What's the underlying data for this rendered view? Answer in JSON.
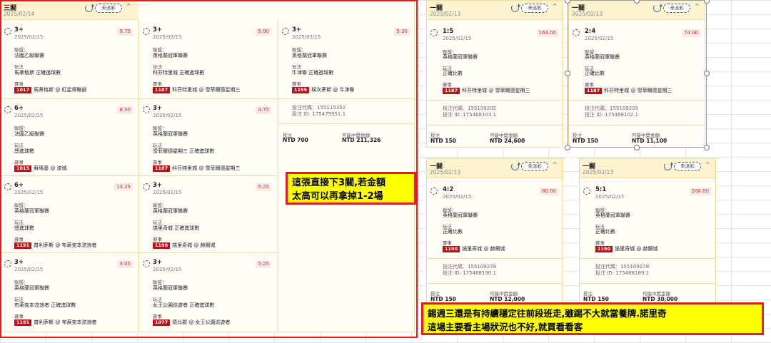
{
  "tickets": {
    "three": {
      "type": "三關",
      "date": "2025/02/14",
      "status": "未派彩",
      "collapse": "^",
      "code": "投注代碼：155115352",
      "id": "投注 ID: 175475951.1",
      "stake_label": "投注",
      "stake": "NTD 700",
      "win_label": "可能中獎金額",
      "win": "NTD 211,326"
    },
    "m1": {
      "type": "一關",
      "date": "2025/02/13",
      "status": "未派彩",
      "collapse": "^",
      "code": "投注代碼：155109205",
      "id": "投注 ID: 175468103.1",
      "stake_label": "投注",
      "stake": "NTD 150",
      "win_label": "可能中獎金額",
      "win": "NTD 24,600"
    },
    "m2": {
      "type": "一關",
      "date": "2025/02/13",
      "status": "未派彩",
      "collapse": "^",
      "code": "投注代碼：155109205",
      "id": "投注 ID: 175468102.1",
      "stake_label": "投注",
      "stake": "NTD 150",
      "win_label": "可能中獎金額",
      "win": "NTD 11,100"
    },
    "m3": {
      "type": "一關",
      "date": "2025/02/13",
      "status": "未派彩",
      "collapse": "^",
      "code": "投注代碼：155109278",
      "id": "投注 ID: 175468190.1",
      "stake_label": "投注",
      "stake": "NTD 150",
      "win_label": "可能中獎金額",
      "win": "NTD 12,000"
    },
    "m4": {
      "type": "一關",
      "date": "2025/02/13",
      "status": "未派彩",
      "collapse": "^",
      "code": "投注代碼：155109278",
      "id": "投注 ID: 175468189.1",
      "stake_label": "投注",
      "stake": "NTD 150",
      "win_label": "可能中獎金額",
      "win": "NTD 30,000"
    }
  },
  "labels": {
    "league": "聯盟：",
    "market": "玩法",
    "match": "賽事"
  },
  "legs": {
    "l1": {
      "sel": "3+",
      "date": "2025/02/15",
      "odds": "9.75",
      "league": "法國乙級聯賽",
      "market": "馬蒂格斯 正確進球數",
      "mid": "1017",
      "match": "馬蒂格斯 @ 紅星保聯部"
    },
    "l2": {
      "sel": "6+",
      "date": "2025/02/15",
      "odds": "8.50",
      "league": "法國乙級聯賽",
      "market": "總進球數",
      "mid": "1015",
      "match": "蘇瑪基 @ 波城"
    },
    "l3": {
      "sel": "6+",
      "date": "2025/02/15",
      "odds": "13.25",
      "league": "英格蘭冠軍聯賽",
      "market": "總進球數",
      "mid": "1191",
      "match": "普利茅斯 @ 布萊克本流浪者"
    },
    "l4": {
      "sel": "3+",
      "date": "2025/02/15",
      "odds": "3.05",
      "league": "英格蘭冠軍聯賽",
      "market": "布萊克本流浪者 正確進球數",
      "mid": "1191",
      "match": "普利茅斯 @ 布萊克本流浪者"
    },
    "l5": {
      "sel": "3+",
      "date": "2025/02/15",
      "odds": "5.90",
      "league": "英格蘭冠軍聯賽",
      "market": "科芬特里城 正確進球數",
      "mid": "1187",
      "match": "科芬特里城 @ 雪菲爾德星期三"
    },
    "l6": {
      "sel": "3+",
      "date": "2025/02/15",
      "odds": "4.75",
      "league": "英格蘭冠軍聯賽",
      "market": "雪菲爾德星期三 正確進球數",
      "mid": "1187",
      "match": "科芬特里城 @ 雪菲爾德星期三"
    },
    "l7": {
      "sel": "3+",
      "date": "2025/02/15",
      "odds": "5.25",
      "league": "英格蘭冠軍聯賽",
      "market": "諾里奇城 正確進球數",
      "mid": "1190",
      "match": "諾里奇城 @ 赫爾城"
    },
    "l8": {
      "sel": "3+",
      "date": "2025/02/15",
      "odds": "5.25",
      "league": "英格蘭冠軍聯賽",
      "market": "女王公園巡遊者 正確進球數",
      "mid": "1077",
      "match": "德比郡 @ 女王公園巡遊者"
    },
    "l9": {
      "sel": "3+",
      "date": "2025/02/15",
      "odds": "5.30",
      "league": "英格蘭冠軍聯賽",
      "market": "牛津聯 正確進球數",
      "mid": "1155",
      "match": "樸次茅斯 @ 牛津聯"
    },
    "m1": {
      "sel": "1:5",
      "date": "2025/02/15",
      "odds": "164.00",
      "league": "英格蘭冠軍聯賽",
      "market": "正確比數",
      "mid": "1187",
      "match": "科芬特里城 @ 雪菲爾德星期三"
    },
    "m2": {
      "sel": "2:4",
      "date": "2025/02/15",
      "odds": "74.00",
      "league": "英格蘭冠軍聯賽",
      "market": "正確比數",
      "mid": "1187",
      "match": "科芬特里城 @ 雪菲爾德星期三"
    },
    "m3": {
      "sel": "4:2",
      "date": "2025/02/15",
      "odds": "80.00",
      "league": "英格蘭冠軍聯賽",
      "market": "正確比數",
      "mid": "1190",
      "match": "諾里奇城 @ 赫爾城"
    },
    "m4": {
      "sel": "5:1",
      "date": "2025/02/15",
      "odds": "200.00",
      "league": "英格蘭冠軍聯賽",
      "market": "正確比數",
      "mid": "1190",
      "match": "諾里奇城 @ 赫爾城"
    }
  },
  "notes": {
    "n1": [
      "這張直接下3關,若金額",
      "太高可以再拿掉1-2場"
    ],
    "n2": [
      "錫週三還是有持續穩定往前段班走,雖踢不大就當養牌.諾里奇",
      "這場主要看主場狀況也不好,就買看看客"
    ]
  },
  "colors": {
    "note_bg": "#ffff00",
    "note_border": "#e02020",
    "header_bg": "#fdf3cf",
    "odds_text": "#c0392b",
    "match_tag": "#b3171c"
  }
}
